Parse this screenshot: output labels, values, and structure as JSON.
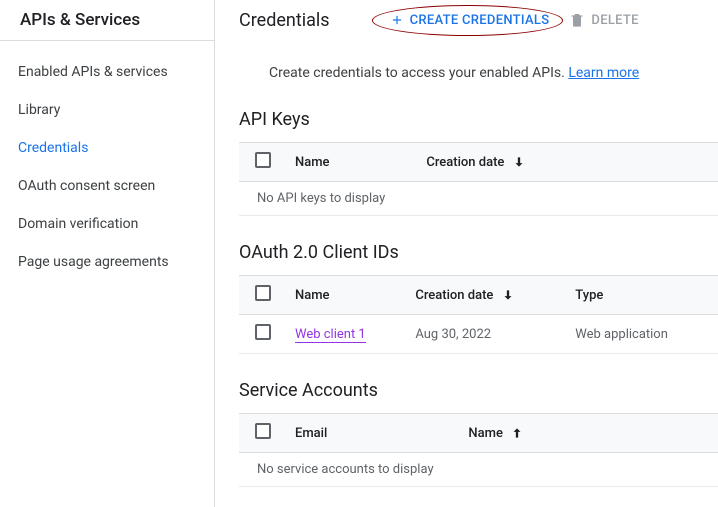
{
  "sidebar": {
    "title": "APIs & Services",
    "items": [
      {
        "label": "Enabled APIs & services"
      },
      {
        "label": "Library"
      },
      {
        "label": "Credentials"
      },
      {
        "label": "OAuth consent screen"
      },
      {
        "label": "Domain verification"
      },
      {
        "label": "Page usage agreements"
      }
    ]
  },
  "header": {
    "page_title": "Credentials",
    "create_label": "CREATE CREDENTIALS",
    "delete_label": "DELETE"
  },
  "intro": {
    "text": "Create credentials to access your enabled APIs. ",
    "learn_more": "Learn more"
  },
  "api_keys": {
    "title": "API Keys",
    "cols": {
      "name": "Name",
      "created": "Creation date"
    },
    "empty": "No API keys to display"
  },
  "oauth": {
    "title": "OAuth 2.0 Client IDs",
    "cols": {
      "name": "Name",
      "created": "Creation date",
      "type": "Type"
    },
    "rows": [
      {
        "name": "Web client 1",
        "created": "Aug 30, 2022",
        "type": "Web application"
      }
    ]
  },
  "service_accounts": {
    "title": "Service Accounts",
    "cols": {
      "email": "Email",
      "name": "Name"
    },
    "empty": "No service accounts to display"
  }
}
